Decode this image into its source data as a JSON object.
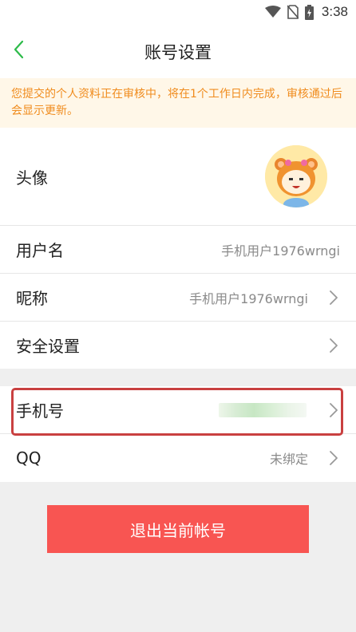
{
  "status_bar": {
    "time": "3:38",
    "icons": [
      "wifi-icon",
      "no-sim-icon",
      "battery-charging-icon"
    ]
  },
  "nav": {
    "title": "账号设置",
    "back_icon": "chevron-left-icon"
  },
  "notice": {
    "text": "您提交的个人资料正在审核中，将在1个工作日内完成，审核通过后会显示更新。"
  },
  "profile": {
    "avatar_label": "头像",
    "username_label": "用户名",
    "username_value": "手机用户1976wrngi",
    "nickname_label": "昵称",
    "nickname_value": "手机用户1976wrngi",
    "security_label": "安全设置"
  },
  "bindings": {
    "phone_label": "手机号",
    "qq_label": "QQ",
    "qq_value": "未绑定"
  },
  "logout_label": "退出当前帐号",
  "colors": {
    "accent_green": "#2dbb4a",
    "notice_text": "#f08c1e",
    "notice_bg": "#fff7e8",
    "logout_bg": "#f85552",
    "highlight": "#c94040"
  }
}
